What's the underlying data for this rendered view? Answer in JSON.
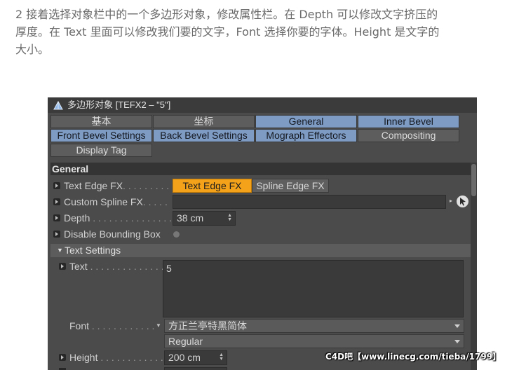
{
  "caption": {
    "line1": "2 接着选择对象栏中的一个多边形对象，修改属性栏。在 Depth 可以修改文字挤压的",
    "line2": "厚度。在 Text 里面可以修改我们要的文字，Font 选择你要的字体。Height 是文字的",
    "line3": "大小。"
  },
  "panel": {
    "title": "多边形对象 [TEFX2 – \"5\"]",
    "tabs": {
      "basic": "基本",
      "coord": "坐标",
      "general": "General",
      "inner_bevel": "Inner Bevel",
      "front_bevel": "Front Bevel Settings",
      "back_bevel": "Back Bevel Settings",
      "mograph": "Mograph Effectors",
      "compositing": "Compositing",
      "display_tag": "Display Tag"
    },
    "section": "General",
    "fields": {
      "text_edge_fx_label": "Text Edge FX",
      "text_edge_fx_dots": ". . . . . . . . . .",
      "btn_text_edge": "Text Edge FX",
      "btn_spline_edge": "Spline Edge FX",
      "custom_spline_label": "Custom Spline FX",
      "custom_spline_dots": ". . . . .",
      "depth_label": "Depth",
      "depth_dots": ". . . . . . . . . . . . . . . . .",
      "depth_value": "38 cm",
      "disable_bbox_label": "Disable Bounding Box",
      "text_settings": "Text Settings",
      "text_label": "Text",
      "text_dots": ". . . . . . . . . . . . . . .",
      "text_value": "5",
      "font_label": "Font",
      "font_dots": ". . . . . . . . . . . .",
      "font_value": "方正兰亭特黑简体",
      "style_value": "Regular",
      "height_label": "Height",
      "height_dots": ". . . . . . . . . . . . .",
      "height_value": "200 cm"
    }
  },
  "watermark": "C4D吧【www.linecg.com/tieba/1799】",
  "colors": {
    "panel_bg": "#4b4b4b",
    "tab_active": "#7e9bc4",
    "button_active": "#f5a21b"
  }
}
